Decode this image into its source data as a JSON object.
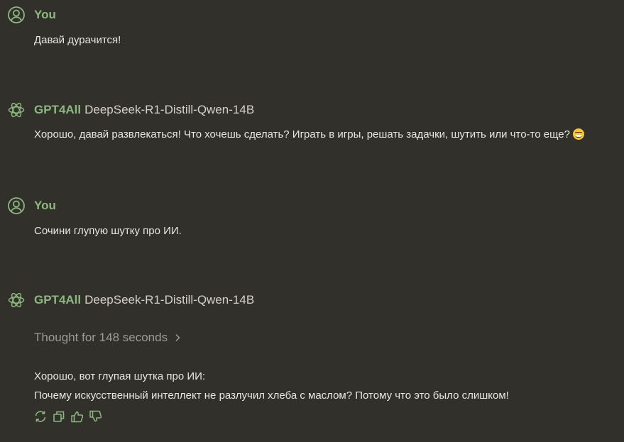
{
  "messages": [
    {
      "role": "user",
      "name": "You",
      "icon": "user-circle-icon",
      "lines": [
        "Давай дурачится!"
      ]
    },
    {
      "role": "assistant",
      "name": "GPT4All",
      "model": "DeepSeek-R1-Distill-Qwen-14B",
      "icon": "gpt4all-logo-icon",
      "lines": [
        "Хорошо, давай развлекаться! Что хочешь сделать? Играть в игры, решать задачки, шутить или что-то еще?"
      ],
      "emoji": "grinning-face-emoji"
    },
    {
      "role": "user",
      "name": "You",
      "icon": "user-circle-icon",
      "lines": [
        "Сочини глупую шутку про ИИ."
      ]
    },
    {
      "role": "assistant",
      "name": "GPT4All",
      "model": "DeepSeek-R1-Distill-Qwen-14B",
      "icon": "gpt4all-logo-icon",
      "thought": "Thought for 148 seconds",
      "lines": [
        "Хорошо, вот глупая шутка про ИИ:",
        "Почему искусственный интеллект не разлучил хлеба с маслом? Потому что это было слишком!"
      ],
      "actions": [
        "regenerate-icon",
        "copy-icon",
        "thumbs-up-icon",
        "thumbs-down-icon"
      ]
    }
  ],
  "colors": {
    "background": "#32302b",
    "accent": "#8cb87f",
    "text": "#e9e6df",
    "muted": "#9e9b93"
  }
}
